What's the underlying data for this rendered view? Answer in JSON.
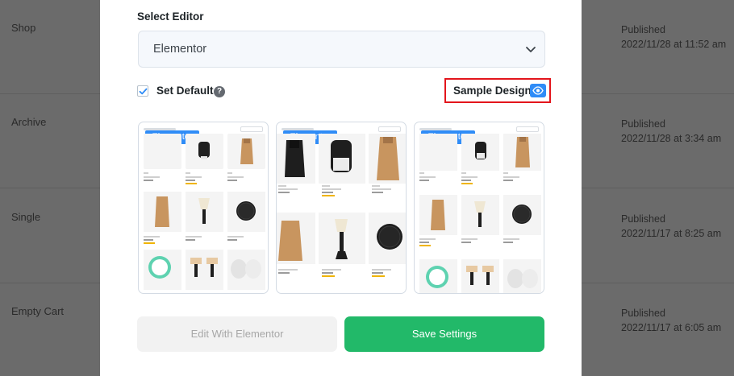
{
  "background_rows": [
    {
      "name": "Shop",
      "status": "Published",
      "date": "2022/11/28 at 11:52 am"
    },
    {
      "name": "Archive",
      "status": "Published",
      "date": "2022/11/28 at 3:34 am"
    },
    {
      "name": "Single",
      "status": "Published",
      "date": "2022/11/17 at 8:25 am"
    },
    {
      "name": "Empty Cart",
      "status": "Published",
      "date": "2022/11/17 at 6:05 am"
    }
  ],
  "modal": {
    "select_editor_label": "Select Editor",
    "editor_value": "Elementor",
    "set_default_label": "Set Default",
    "set_default_checked": true,
    "help_icon": "?",
    "sample_design_label": "Sample Design",
    "cards": [
      {
        "badge": "Elementor"
      },
      {
        "badge": "Elementor"
      },
      {
        "badge": "Elementor"
      }
    ],
    "edit_button_label": "Edit With Elementor",
    "save_button_label": "Save Settings"
  },
  "colors": {
    "accent_blue": "#2f8cf7",
    "save_green": "#22b969",
    "highlight_red": "#e3151c",
    "overlay": "#6b6b6b"
  },
  "icons": {
    "chevron": "chevron-down-icon",
    "check": "check-icon",
    "help": "question-circle-icon",
    "eye": "eye-icon"
  }
}
